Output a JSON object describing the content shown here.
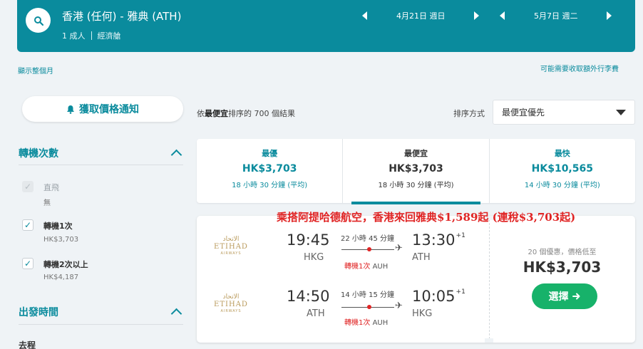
{
  "header": {
    "route": "香港 (任何) - 雅典 (ATH)",
    "passengers": "1 成人",
    "cabin": "經濟艙",
    "depart_date": "4月21日 週日",
    "return_date": "5月7日 週二",
    "search_icon": "search-icon"
  },
  "links": {
    "show_month": "顯示整個月",
    "baggage_fees": "可能需要收取額外行李費"
  },
  "sidebar": {
    "price_alert": "獲取價格通知",
    "stops_title": "轉機次數",
    "stops": [
      {
        "label": "直飛",
        "sub": "無",
        "checked": true,
        "disabled": true
      },
      {
        "label": "轉機1次",
        "sub": "HK$3,703",
        "checked": true,
        "disabled": false
      },
      {
        "label": "轉機2次以上",
        "sub": "HK$4,187",
        "checked": true,
        "disabled": false
      }
    ],
    "departure_title": "出發時間",
    "outbound_label": "去程"
  },
  "results": {
    "count_prefix": "依",
    "count_sort": "最便宜",
    "count_suffix": "排序的 700 個結果",
    "sort_label": "排序方式",
    "sort_value": "最便宜優先"
  },
  "tabs": [
    {
      "title": "最優",
      "price": "HK$3,703",
      "duration": "18 小時 30 分鐘 (平均)",
      "active": false
    },
    {
      "title": "最便宜",
      "price": "HK$3,703",
      "duration": "18 小時 30 分鐘 (平均)",
      "active": true
    },
    {
      "title": "最快",
      "price": "HK$10,565",
      "duration": "14 小時 30 分鐘 (平均)",
      "active": false
    }
  ],
  "promo": "乘搭阿提哈德航空，香港來回雅典$1,589起 (連稅$3,703起)",
  "result": {
    "airline": {
      "arabic": "الاتحاد",
      "name": "ETIHAD",
      "sub": "AIRWAYS"
    },
    "outbound": {
      "depart_time": "19:45",
      "depart_airport": "HKG",
      "arrive_time": "13:30",
      "arrive_offset": "+1",
      "arrive_airport": "ATH",
      "duration": "22 小時 45 分鐘",
      "stops": "轉機1次",
      "via": "AUH"
    },
    "inbound": {
      "depart_time": "14:50",
      "depart_airport": "ATH",
      "arrive_time": "10:05",
      "arrive_offset": "+1",
      "arrive_airport": "HKG",
      "duration": "14 小時 15 分鐘",
      "stops": "轉機1次",
      "via": "AUH"
    },
    "deals": "20 個優惠，價格低至",
    "price": "HK$3,703",
    "select_label": "選擇"
  },
  "colors": {
    "brand": "#0a8b9d",
    "select": "#17b26a",
    "promo": "#e02424",
    "stop_dot": "#e02424"
  }
}
